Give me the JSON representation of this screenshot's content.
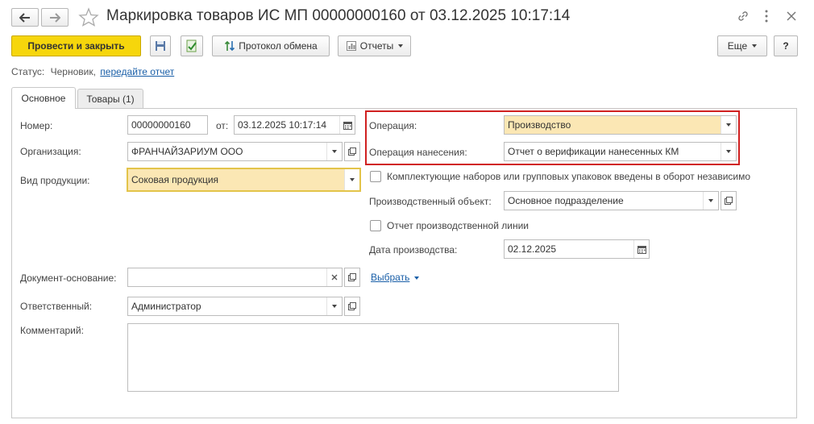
{
  "window": {
    "title": "Маркировка товаров ИС МП 00000000160 от 03.12.2025 10:17:14"
  },
  "toolbar": {
    "post_close": "Провести и закрыть",
    "exchange_protocol": "Протокол обмена",
    "reports": "Отчеты",
    "more": "Еще",
    "help": "?"
  },
  "status": {
    "label": "Статус:",
    "value": "Черновик,",
    "link": "передайте отчет"
  },
  "tabs": [
    {
      "label": "Основное"
    },
    {
      "label": "Товары (1)"
    }
  ],
  "form": {
    "number_label": "Номер:",
    "number_value": "00000000160",
    "from_label": "от:",
    "date_value": "03.12.2025 10:17:14",
    "org_label": "Организация:",
    "org_value": "ФРАНЧАЙЗАРИУМ ООО",
    "product_type_label": "Вид продукции:",
    "product_type_value": "Соковая продукция",
    "base_doc_label": "Документ-основание:",
    "base_doc_value": "",
    "choose_link": "Выбрать",
    "responsible_label": "Ответственный:",
    "responsible_value": "Администратор",
    "comment_label": "Комментарий:",
    "operation_label": "Операция:",
    "operation_value": "Производство",
    "apply_op_label": "Операция нанесения:",
    "apply_op_value": "Отчет о верификации нанесенных КМ",
    "kits_checkbox_label": "Комплектующие наборов или групповых упаковок введены в оборот независимо",
    "prod_object_label": "Производственный объект:",
    "prod_object_value": "Основное подразделение",
    "line_report_label": "Отчет производственной линии",
    "prod_date_label": "Дата производства:",
    "prod_date_value": "02.12.2025"
  },
  "colors": {
    "accent_yellow": "#f6d60c",
    "highlight_border": "#d02020",
    "link": "#1a5fa8",
    "field_yellow": "#fbe7b4"
  }
}
